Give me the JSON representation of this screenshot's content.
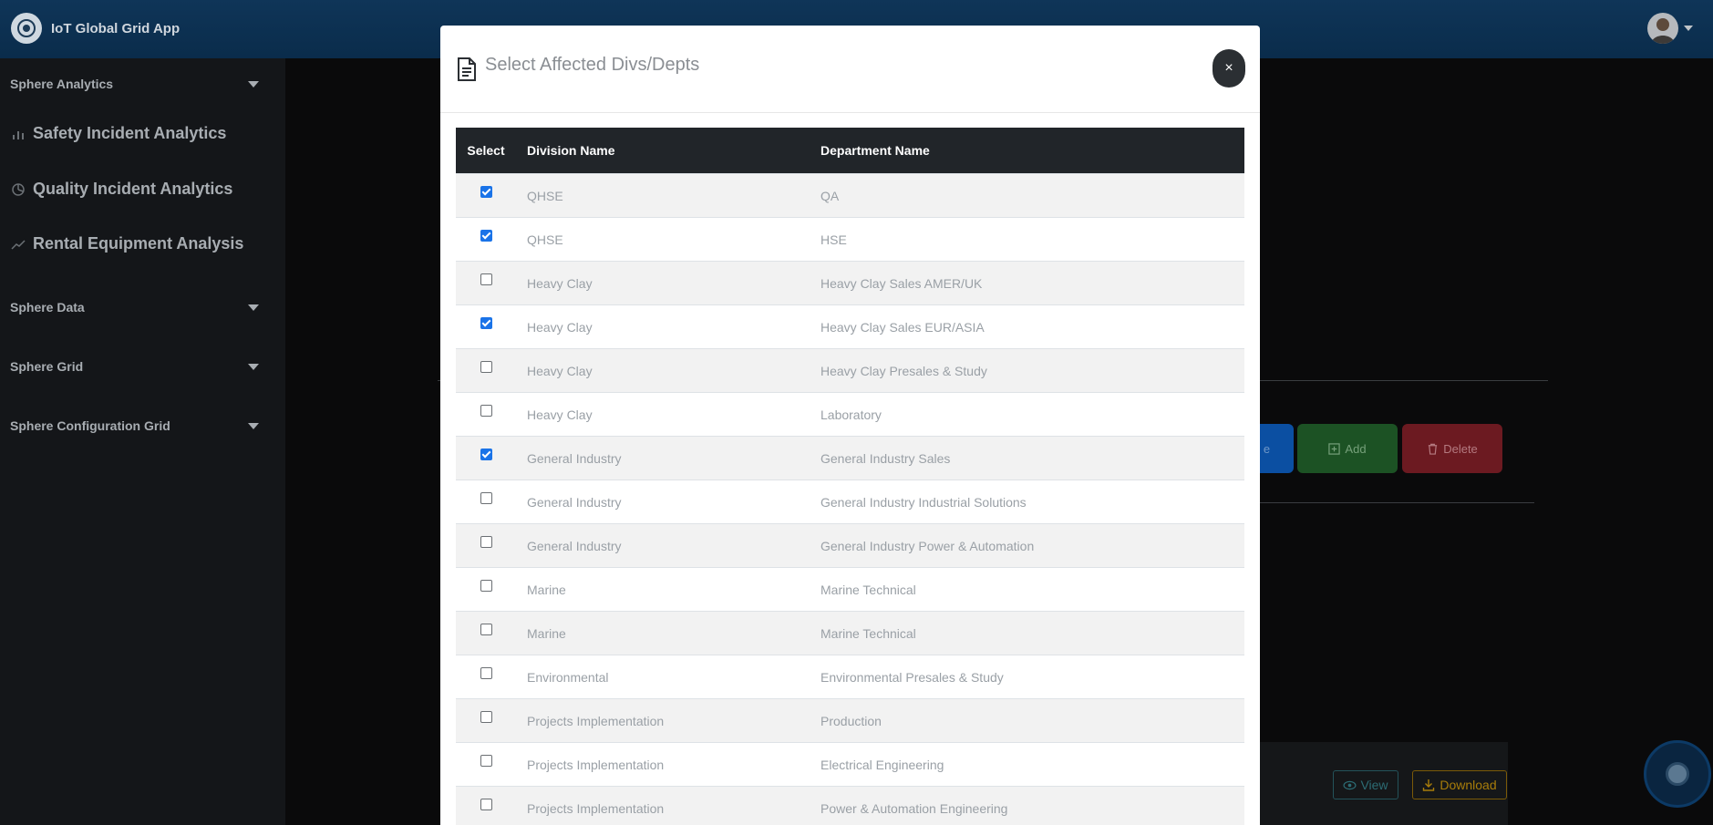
{
  "app": {
    "title": "IoT Global Grid App"
  },
  "sidebar": {
    "sections": [
      {
        "label": "Sphere Analytics"
      },
      {
        "label": "Sphere Data"
      },
      {
        "label": "Sphere Grid"
      },
      {
        "label": "Sphere Configuration Grid"
      }
    ],
    "items": [
      {
        "label": "Safety Incident Analytics",
        "icon": "bar-chart-icon"
      },
      {
        "label": "Quality Incident Analytics",
        "icon": "pie-chart-icon"
      },
      {
        "label": "Rental Equipment Analysis",
        "icon": "line-chart-icon"
      }
    ]
  },
  "background": {
    "add_label": "Add",
    "delete_label": "Delete",
    "view_label": "View",
    "download_label": "Download",
    "partial_blue_label": "e"
  },
  "modal": {
    "title": "Select Affected Divs/Depts",
    "close_label": "×",
    "columns": {
      "select": "Select",
      "division": "Division Name",
      "department": "Department Name"
    },
    "rows": [
      {
        "checked": true,
        "division": "QHSE",
        "department": "QA"
      },
      {
        "checked": true,
        "division": "QHSE",
        "department": "HSE"
      },
      {
        "checked": false,
        "division": "Heavy Clay",
        "department": "Heavy Clay Sales AMER/UK"
      },
      {
        "checked": true,
        "division": "Heavy Clay",
        "department": "Heavy Clay Sales EUR/ASIA"
      },
      {
        "checked": false,
        "division": "Heavy Clay",
        "department": "Heavy Clay Presales & Study"
      },
      {
        "checked": false,
        "division": "Heavy Clay",
        "department": "Laboratory"
      },
      {
        "checked": true,
        "division": "General Industry",
        "department": "General Industry Sales"
      },
      {
        "checked": false,
        "division": "General Industry",
        "department": "General Industry Industrial Solutions"
      },
      {
        "checked": false,
        "division": "General Industry",
        "department": "General Industry Power & Automation"
      },
      {
        "checked": false,
        "division": "Marine",
        "department": "Marine Technical"
      },
      {
        "checked": false,
        "division": "Marine",
        "department": "Marine Technical"
      },
      {
        "checked": false,
        "division": "Environmental",
        "department": "Environmental Presales & Study"
      },
      {
        "checked": false,
        "division": "Projects Implementation",
        "department": "Production"
      },
      {
        "checked": false,
        "division": "Projects Implementation",
        "department": "Electrical Engineering"
      },
      {
        "checked": false,
        "division": "Projects Implementation",
        "department": "Power & Automation Engineering"
      }
    ]
  }
}
